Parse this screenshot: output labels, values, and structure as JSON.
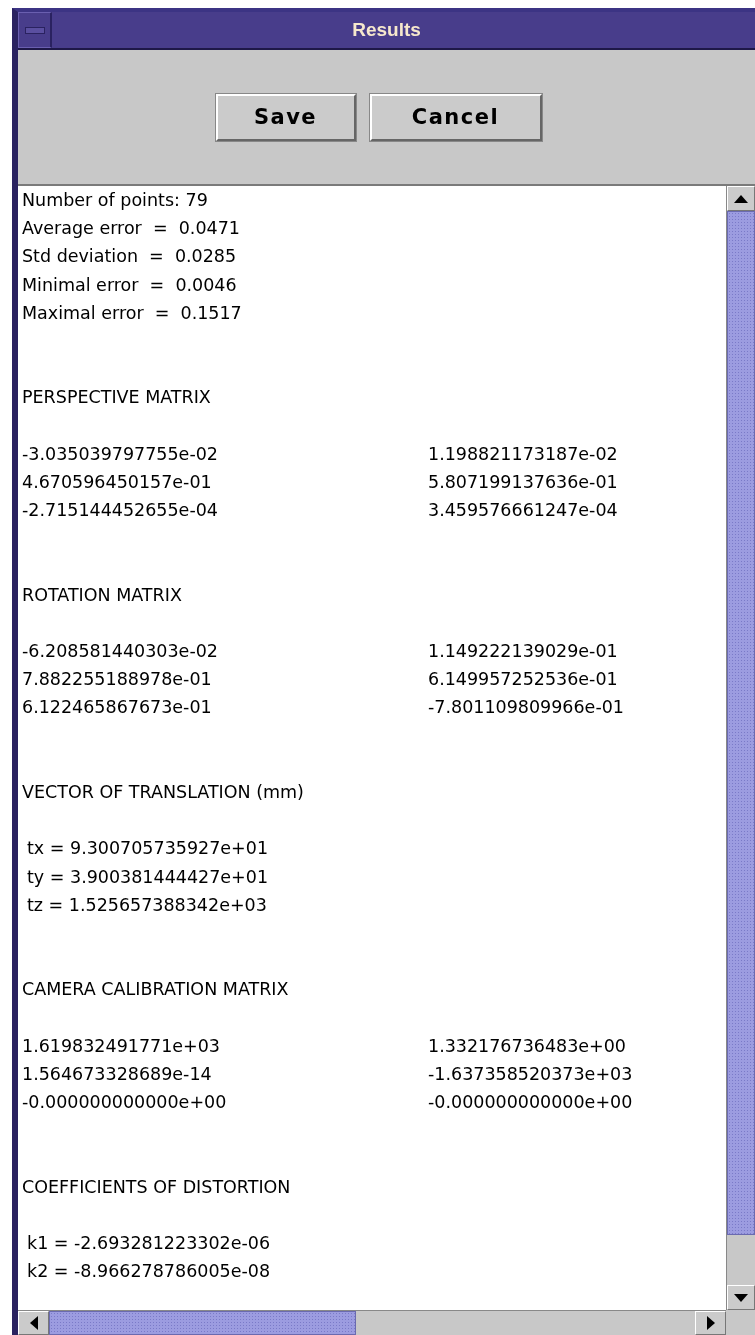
{
  "window": {
    "title": "Results"
  },
  "buttons": [
    {
      "label": "Save"
    },
    {
      "label": "Cancel"
    }
  ],
  "stats": [
    "Number of points: 79",
    "Average error  =  0.0471",
    "Std deviation  =  0.0285",
    "Minimal error  =  0.0046",
    "Maximal error  =  0.1517"
  ],
  "sections": [
    {
      "kind": "matrix",
      "title": "PERSPECTIVE MATRIX",
      "rows": [
        [
          "-3.035039797755e-02",
          "1.198821173187e-02"
        ],
        [
          "4.670596450157e-01",
          "5.807199137636e-01"
        ],
        [
          "-2.715144452655e-04",
          "3.459576661247e-04"
        ]
      ]
    },
    {
      "kind": "matrix",
      "title": "ROTATION MATRIX",
      "rows": [
        [
          "-6.208581440303e-02",
          "1.149222139029e-01"
        ],
        [
          "7.882255188978e-01",
          "6.149957252536e-01"
        ],
        [
          "6.122465867673e-01",
          "-7.801109809966e-01"
        ]
      ]
    },
    {
      "kind": "list",
      "title": "VECTOR OF TRANSLATION (mm)",
      "rows": [
        "tx = 9.300705735927e+01",
        "ty = 3.900381444427e+01",
        "tz = 1.525657388342e+03"
      ]
    },
    {
      "kind": "matrix",
      "title": "CAMERA CALIBRATION MATRIX",
      "rows": [
        [
          "1.619832491771e+03",
          "1.332176736483e+00"
        ],
        [
          "1.564673328689e-14",
          "-1.637358520373e+03"
        ],
        [
          "-0.000000000000e+00",
          "-0.000000000000e+00"
        ]
      ]
    },
    {
      "kind": "list",
      "title": "COEFFICIENTS OF DISTORTION",
      "rows": [
        "k1 = -2.693281223302e-06",
        "k2 = -8.966278786005e-08"
      ]
    }
  ]
}
